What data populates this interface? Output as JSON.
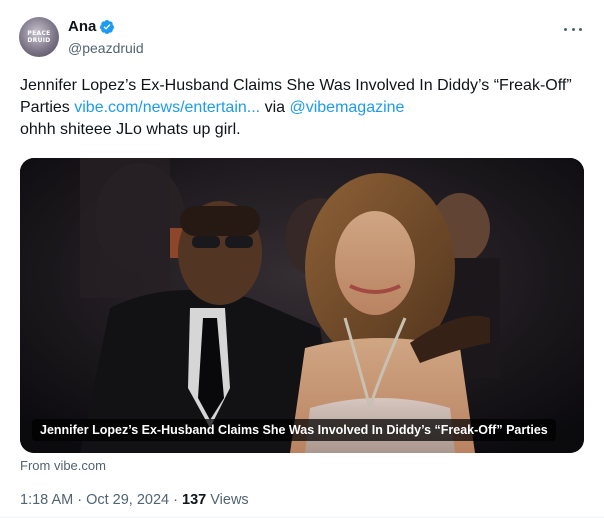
{
  "author": {
    "display_name": "Ana",
    "handle": "@peazdruid",
    "avatar_text": "PEACE DRUID",
    "verified_icon": "verified-badge-icon",
    "accent_color": "#1d9bf0"
  },
  "tweet": {
    "text_part1": "Jennifer Lopez’s Ex-Husband Claims She Was Involved In Diddy’s “Freak-Off” Parties ",
    "link_text": "vibe.com/news/entertain...",
    "text_via": " via ",
    "mention": "@vibemagazine",
    "line2": "ohhh shiteee JLo whats up girl."
  },
  "card": {
    "caption": "Jennifer Lopez’s Ex-Husband Claims She Was Involved In Diddy’s “Freak-Off” Parties",
    "source": "From vibe.com"
  },
  "meta": {
    "time": "1:18 AM",
    "separator": " · ",
    "date": "Oct 29, 2024",
    "views_count": "137",
    "views_label": " Views"
  },
  "icons": {
    "more": "more-horizontal-icon"
  }
}
